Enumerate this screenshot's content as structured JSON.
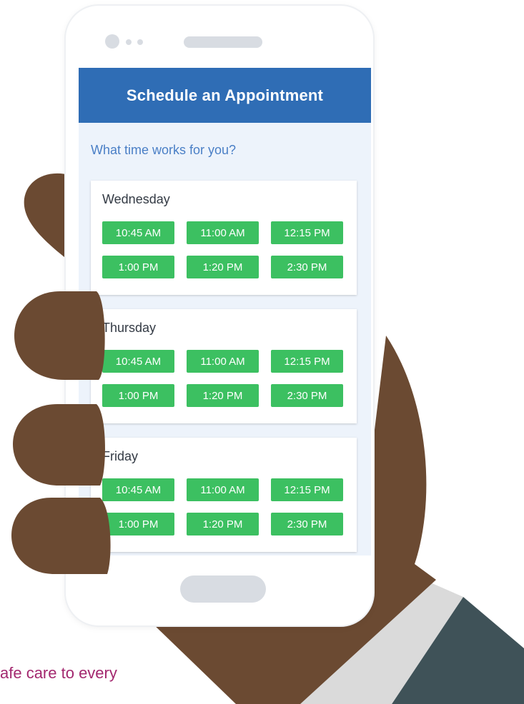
{
  "colors": {
    "header": "#2f6db5",
    "screen_background": "#edf3fb",
    "time_slot": "#3cc061",
    "question_text": "#4a7fc6",
    "caption_text": "#a3286f",
    "skin": "#6b4a32",
    "sleeve": "#3f5258",
    "cuff": "#dadada"
  },
  "icons": [
    "phone-camera-icon",
    "phone-speaker-icon",
    "phone-home-button-icon"
  ],
  "app": {
    "title": "Schedule an Appointment",
    "question": "What time works for you?"
  },
  "days": [
    {
      "name": "Wednesday",
      "slots": [
        "10:45 AM",
        "11:00 AM",
        "12:15 PM",
        "1:00 PM",
        "1:20 PM",
        "2:30 PM"
      ]
    },
    {
      "name": "Thursday",
      "slots": [
        "10:45 AM",
        "11:00 AM",
        "12:15 PM",
        "1:00 PM",
        "1:20 PM",
        "2:30 PM"
      ]
    },
    {
      "name": "Friday",
      "slots": [
        "10:45 AM",
        "11:00 AM",
        "12:15 PM",
        "1:00 PM",
        "1:20 PM",
        "2:30 PM"
      ]
    }
  ],
  "caption": "afe care to every"
}
